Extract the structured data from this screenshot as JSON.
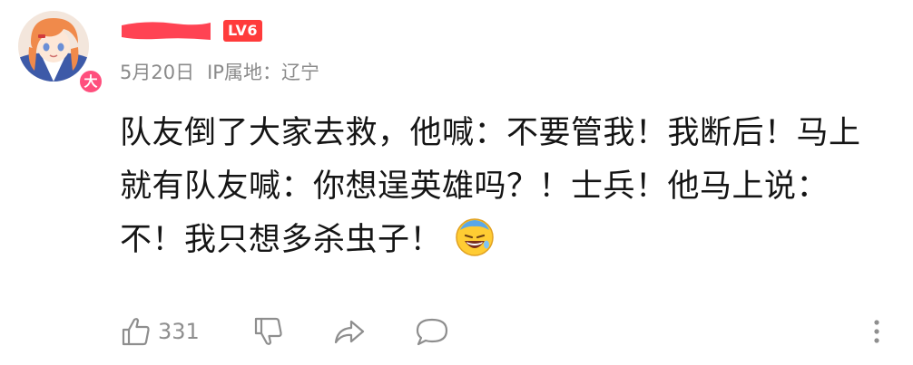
{
  "user": {
    "avatar_badge": "大",
    "level": "LV6"
  },
  "meta": {
    "date": "5月20日",
    "ip_location": "IP属地：辽宁"
  },
  "comment": {
    "text": "队友倒了大家去救，他喊：不要管我！我断后！马上就有队友喊：你想逞英雄吗？！士兵！他马上说：不！我只想多杀虫子！",
    "emoji": "grinning-sweat-emoji"
  },
  "actions": {
    "like_count": "331",
    "icons": [
      "thumbs-up-icon",
      "thumbs-down-icon",
      "share-icon",
      "reply-icon",
      "more-icon"
    ]
  },
  "colors": {
    "level_badge": "#ff3b3b",
    "avatar_badge": "#ff4f7d",
    "meta_text": "#8a8a8a",
    "icon": "#8e8e8e"
  }
}
